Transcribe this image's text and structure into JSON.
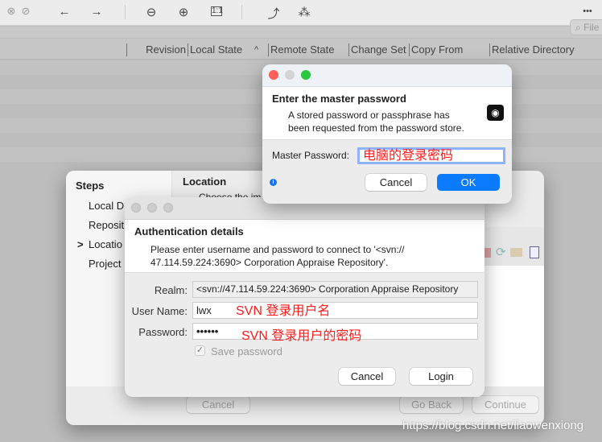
{
  "toolbar": {
    "icons": [
      "close-circle-icon",
      "block-icon",
      "back-arrow-icon",
      "forward-arrow-icon",
      "zoom-out-icon",
      "zoom-in-icon",
      "actual-size-icon",
      "rotate-icon",
      "magic-wand-icon",
      "more-icon"
    ],
    "more": "•••"
  },
  "search": {
    "placeholder": "File Fi"
  },
  "columns": [
    "Revision",
    "Local State",
    "^",
    "Remote State",
    "Change Set",
    "Copy From",
    "Relative Directory"
  ],
  "wizard": {
    "steps_title": "Steps",
    "steps": [
      "Local D",
      "Reposit",
      "Locatio",
      "Project"
    ],
    "current_marker": ">",
    "section_title": "Location",
    "section_desc": "Choose the im",
    "cancel": "Cancel",
    "go_back": "Go Back",
    "continue": "Continue"
  },
  "auth": {
    "title": "Authentication details",
    "message": "Please enter username and password to connect to '<svn://47.114.59.224:3690> Corporation Appraise Repository'.",
    "message_line1": "Please enter username and password to connect to '<svn://",
    "message_line2": "47.114.59.224:3690> Corporation Appraise Repository'.",
    "realm_label": "Realm:",
    "realm_value": "<svn://47.114.59.224:3690> Corporation Appraise Repository",
    "username_label": "User Name:",
    "username_value": "lwx",
    "username_note": "SVN 登录用户名",
    "password_label": "Password:",
    "password_value": "••••••",
    "password_note": "SVN 登录用户的密码",
    "save_password": "Save password",
    "save_password_checked": true,
    "cancel": "Cancel",
    "login": "Login"
  },
  "master": {
    "title": "Enter the master password",
    "desc_line1": "A stored password or passphrase has",
    "desc_line2": "been requested from the password store.",
    "field_label": "Master Password:",
    "field_note": "电脑的登录密码",
    "cancel": "Cancel",
    "ok": "OK"
  },
  "watermark": "https://blog.csdn.net/liaowenxiong",
  "colors": {
    "accent": "#0a7aff",
    "annotation": "#ff1a1a"
  }
}
